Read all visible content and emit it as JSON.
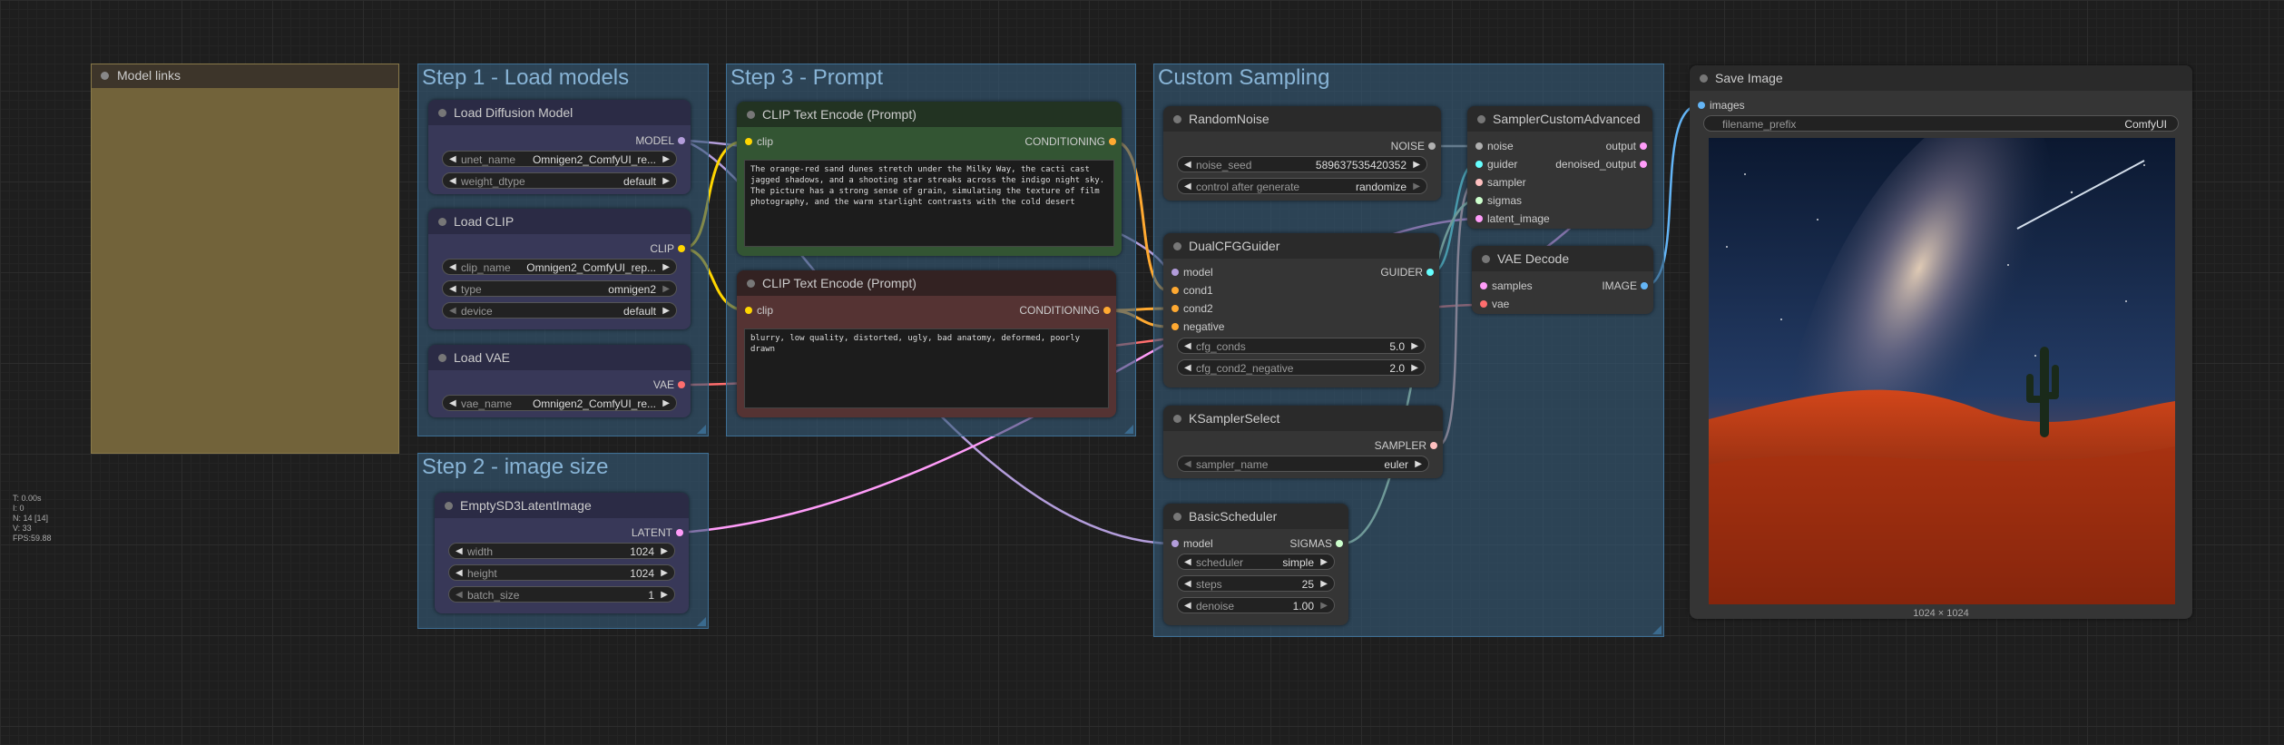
{
  "groups": {
    "model_links": "Model links",
    "step1": "Step 1 - Load models",
    "step2": "Step 2 - image size",
    "step3": "Step 3 - Prompt",
    "custom_sampling": "Custom Sampling"
  },
  "load_diffusion": {
    "title": "Load Diffusion Model",
    "out": "MODEL",
    "w1_label": "unet_name",
    "w1_value": "Omnigen2_ComfyUI_re...",
    "w2_label": "weight_dtype",
    "w2_value": "default"
  },
  "load_clip": {
    "title": "Load CLIP",
    "out": "CLIP",
    "w1_label": "clip_name",
    "w1_value": "Omnigen2_ComfyUI_rep...",
    "w2_label": "type",
    "w2_value": "omnigen2",
    "w3_label": "device",
    "w3_value": "default"
  },
  "load_vae": {
    "title": "Load VAE",
    "out": "VAE",
    "w1_label": "vae_name",
    "w1_value": "Omnigen2_ComfyUI_re..."
  },
  "latent": {
    "title": "EmptySD3LatentImage",
    "out": "LATENT",
    "w1_label": "width",
    "w1_value": "1024",
    "w2_label": "height",
    "w2_value": "1024",
    "w3_label": "batch_size",
    "w3_value": "1"
  },
  "clip_pos": {
    "title": "CLIP Text Encode (Prompt)",
    "in": "clip",
    "out": "CONDITIONING",
    "text": "The orange-red sand dunes stretch under the Milky Way, the cacti cast jagged shadows, and a shooting star streaks across the indigo night sky. The picture has a strong sense of grain, simulating the texture of film photography, and the warm starlight contrasts with the cold desert"
  },
  "clip_neg": {
    "title": "CLIP Text Encode (Prompt)",
    "in": "clip",
    "out": "CONDITIONING",
    "text": "blurry, low quality, distorted, ugly, bad anatomy, deformed, poorly drawn"
  },
  "random_noise": {
    "title": "RandomNoise",
    "out": "NOISE",
    "w1_label": "noise_seed",
    "w1_value": "589637535420352",
    "w2_label": "control after generate",
    "w2_value": "randomize"
  },
  "dual_cfg": {
    "title": "DualCFGGuider",
    "in1": "model",
    "in2": "cond1",
    "in3": "cond2",
    "in4": "negative",
    "out": "GUIDER",
    "w1_label": "cfg_conds",
    "w1_value": "5.0",
    "w2_label": "cfg_cond2_negative",
    "w2_value": "2.0"
  },
  "ksampler_select": {
    "title": "KSamplerSelect",
    "out": "SAMPLER",
    "w1_label": "sampler_name",
    "w1_value": "euler"
  },
  "basic_scheduler": {
    "title": "BasicScheduler",
    "in1": "model",
    "out": "SIGMAS",
    "w1_label": "scheduler",
    "w1_value": "simple",
    "w2_label": "steps",
    "w2_value": "25",
    "w3_label": "denoise",
    "w3_value": "1.00"
  },
  "sampler_adv": {
    "title": "SamplerCustomAdvanced",
    "in1": "noise",
    "in2": "guider",
    "in3": "sampler",
    "in4": "sigmas",
    "in5": "latent_image",
    "out1": "output",
    "out2": "denoised_output"
  },
  "vae_decode": {
    "title": "VAE Decode",
    "in1": "samples",
    "in2": "vae",
    "out": "IMAGE"
  },
  "save_image": {
    "title": "Save Image",
    "in": "images",
    "w1_label": "filename_prefix",
    "w1_value": "ComfyUI",
    "size_caption": "1024 × 1024"
  },
  "stats": {
    "t": "T: 0.00s",
    "i": "I: 0",
    "n": "N: 14 [14]",
    "v": "V: 33",
    "fps": "FPS:59.88"
  },
  "colors": {
    "model": "#b39ddb",
    "clip": "#ffd500",
    "vae": "#ff6e6e",
    "latent": "#ff9cf9",
    "conditioning": "#ffa931",
    "noise": "#b0b0b0",
    "guider": "#66ffff",
    "sampler": "#ffc0c0",
    "sigmas": "#cdffcd",
    "image": "#64b5f6"
  }
}
